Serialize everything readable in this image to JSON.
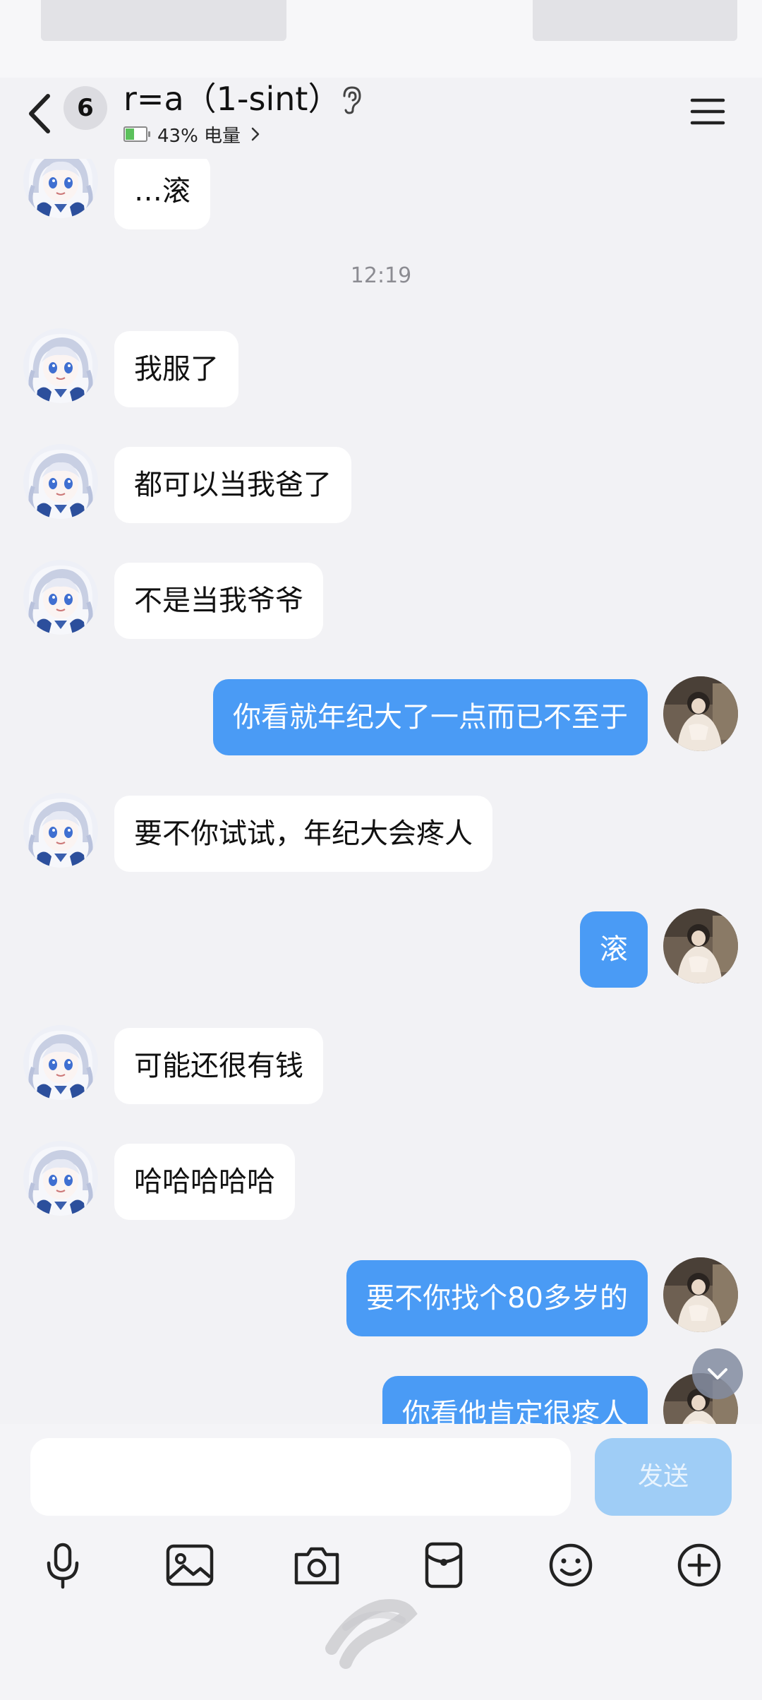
{
  "header": {
    "unread_count": "6",
    "title": "r=a（1-sint）",
    "battery_percent": 43,
    "subtitle": "43% 电量"
  },
  "messages": [
    {
      "side": "left",
      "text": "…滚"
    },
    {
      "type": "time",
      "text": "12:19"
    },
    {
      "side": "left",
      "text": "我服了"
    },
    {
      "side": "left",
      "text": "都可以当我爸了"
    },
    {
      "side": "left",
      "text": "不是当我爷爷"
    },
    {
      "side": "right",
      "text": "你看就年纪大了一点而已不至于"
    },
    {
      "side": "left",
      "text": "要不你试试，年纪大会疼人"
    },
    {
      "side": "right",
      "text": "滚"
    },
    {
      "side": "left",
      "text": "可能还很有钱"
    },
    {
      "side": "left",
      "text": "哈哈哈哈哈"
    },
    {
      "side": "right",
      "text": "要不你找个80多岁的"
    },
    {
      "side": "right",
      "text": "你看他肯定很疼人"
    }
  ],
  "input": {
    "value": "",
    "send_label": "发送"
  },
  "toolbar": [
    "microphone-icon",
    "image-icon",
    "camera-icon",
    "red-packet-icon",
    "emoji-icon",
    "plus-icon"
  ],
  "colors": {
    "outgoing_bubble": "#4a9bf5",
    "incoming_bubble": "#ffffff",
    "send_button": "#9fcdf6",
    "background": "#f2f2f5"
  }
}
